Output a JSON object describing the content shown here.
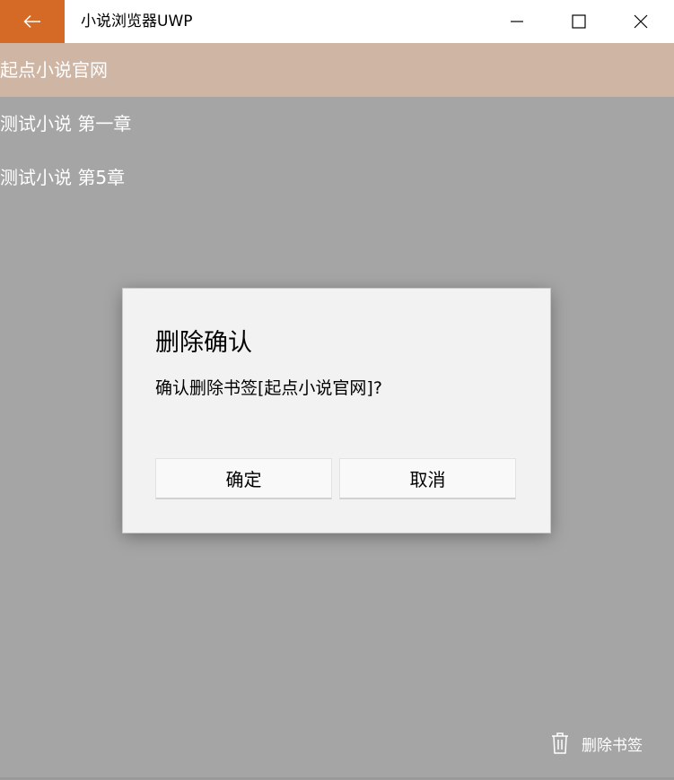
{
  "window": {
    "title": "小说浏览器UWP",
    "accent_color": "#d46a26"
  },
  "caption_buttons": {
    "minimize_icon": "minimize-icon",
    "maximize_icon": "maximize-icon",
    "close_icon": "close-icon"
  },
  "bookmarks": {
    "items": [
      {
        "label": "起点小说官网",
        "selected": true
      },
      {
        "label": "测试小说 第一章",
        "selected": false
      },
      {
        "label": "测试小说 第5章",
        "selected": false
      }
    ],
    "selected_color": "#cfb5a4"
  },
  "bottom_bar": {
    "delete_label": "删除书签",
    "delete_icon": "trash-icon"
  },
  "dialog": {
    "title": "删除确认",
    "message": "确认删除书签[起点小说官网]?",
    "confirm_label": "确定",
    "cancel_label": "取消"
  }
}
